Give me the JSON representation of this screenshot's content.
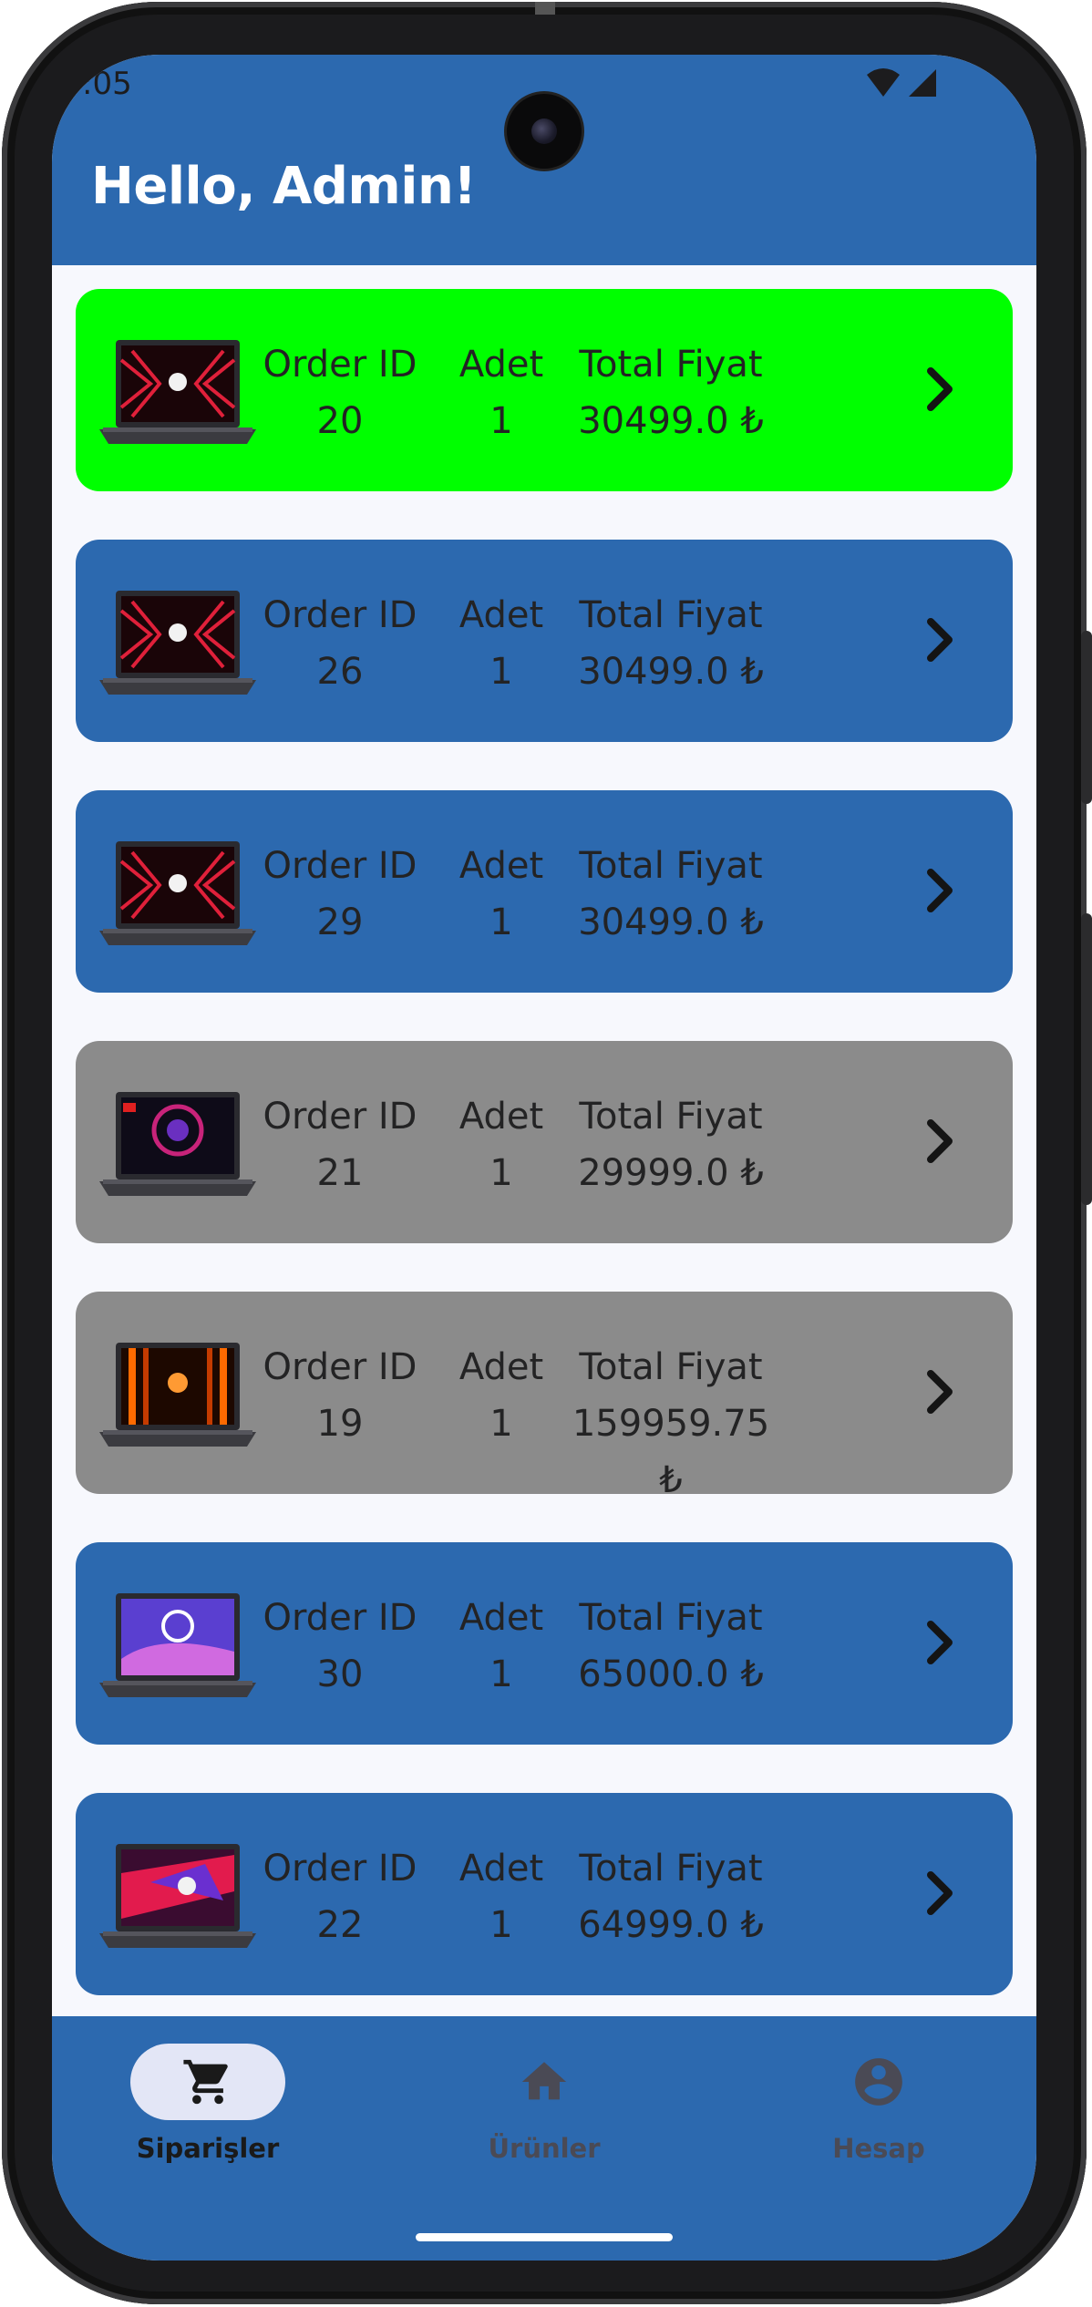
{
  "status_bar": {
    "time": ":05",
    "wifi_icon": "wifi-icon",
    "signal_icon": "signal-icon"
  },
  "header": {
    "greeting": "Hello, Admin!",
    "color": "#2c69af"
  },
  "column_labels": {
    "order_id": "Order ID",
    "qty": "Adet",
    "total": "Total Fiyat"
  },
  "colors": {
    "highlight": "#00ff00",
    "blue": "#2c69af",
    "gray": "#8b8b8b"
  },
  "orders": [
    {
      "order_id": "20",
      "qty": "1",
      "total": "30499.0 ₺",
      "status_color": "#00ff00",
      "thumb": "laptop-red-thumbnail"
    },
    {
      "order_id": "26",
      "qty": "1",
      "total": "30499.0 ₺",
      "status_color": "#2c69af",
      "thumb": "laptop-red-thumbnail"
    },
    {
      "order_id": "29",
      "qty": "1",
      "total": "30499.0 ₺",
      "status_color": "#2c69af",
      "thumb": "laptop-red-thumbnail"
    },
    {
      "order_id": "21",
      "qty": "1",
      "total": "29999.0 ₺",
      "status_color": "#8b8b8b",
      "thumb": "laptop-purple-thumbnail"
    },
    {
      "order_id": "19",
      "qty": "1",
      "total": "159959.75 ₺",
      "status_color": "#8b8b8b",
      "thumb": "laptop-orange-thumbnail"
    },
    {
      "order_id": "30",
      "qty": "1",
      "total": "65000.0 ₺",
      "status_color": "#2c69af",
      "thumb": "laptop-ai-thumbnail"
    },
    {
      "order_id": "22",
      "qty": "1",
      "total": "64999.0 ₺",
      "status_color": "#2c69af",
      "thumb": "laptop-rog-thumbnail"
    }
  ],
  "bottom_nav": {
    "items": [
      {
        "label": "Siparişler",
        "icon": "shopping-cart-icon",
        "active": true
      },
      {
        "label": "Ürünler",
        "icon": "home-icon",
        "active": false
      },
      {
        "label": "Hesap",
        "icon": "account-circle-icon",
        "active": false
      }
    ]
  }
}
